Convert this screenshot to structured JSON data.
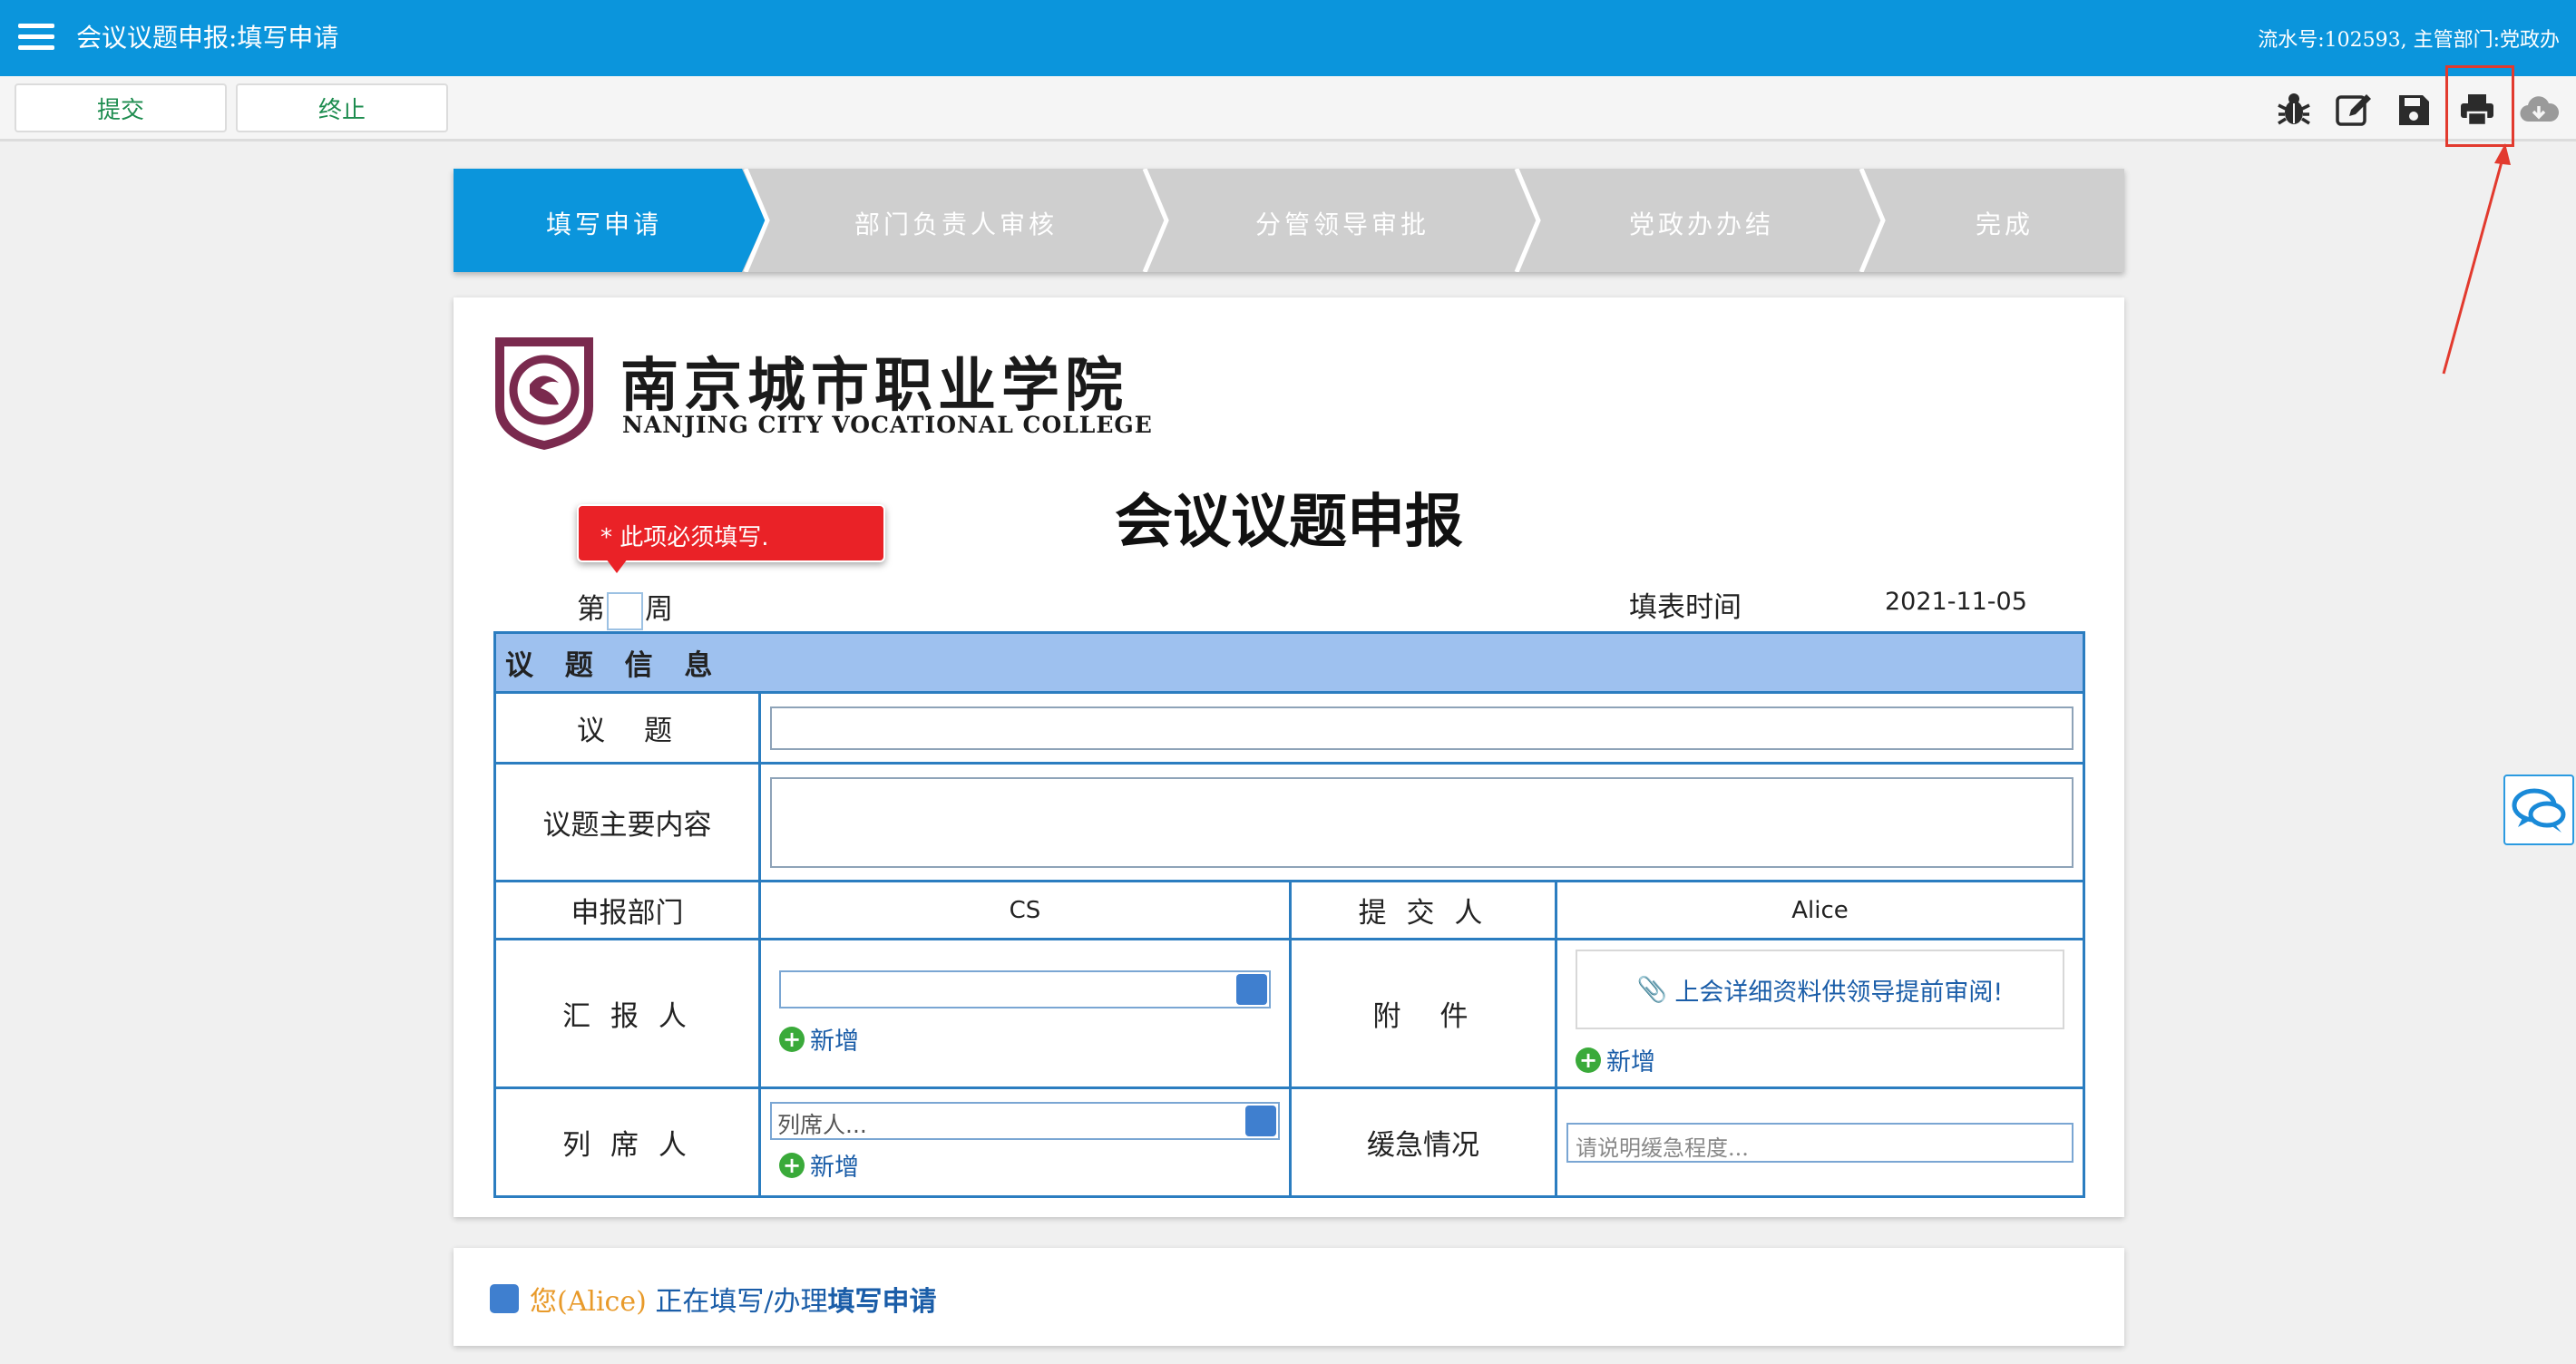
{
  "header": {
    "title": "会议议题申报:填写申请",
    "meta": "流水号:102593, 主管部门:党政办"
  },
  "toolbar": {
    "submit_label": "提交",
    "terminate_label": "终止",
    "icons": [
      "bug-icon",
      "edit-icon",
      "save-icon",
      "print-icon",
      "cloud-download-icon"
    ]
  },
  "steps": [
    {
      "label": "填写申请",
      "active": true
    },
    {
      "label": "部门负责人审核",
      "active": false
    },
    {
      "label": "分管领导审批",
      "active": false
    },
    {
      "label": "党政办办结",
      "active": false
    },
    {
      "label": "完成",
      "active": false
    }
  ],
  "colors": {
    "brand": "#0b95dc",
    "step_inactive": "#cfcfcf",
    "table_border": "#2b7dc0",
    "section_head": "#9ec1ef",
    "tooltip": "#ea2227",
    "logo": "#7a2a4e"
  },
  "logo": {
    "name_cn": "南京城市职业学院",
    "name_en": "NANJING CITY VOCATIONAL COLLEGE"
  },
  "form": {
    "title": "会议议题申报",
    "tooltip": "* 此项必须填写.",
    "week_prefix": "第",
    "week_suffix": "周",
    "date_label": "填表时间",
    "date_value": "2021-11-05",
    "section_title": "议 题 信 息",
    "topic_label": "议　题",
    "content_label": "议题主要内容",
    "dept_label": "申报部门",
    "dept_value": "CS",
    "submitter_label": "提 交 人",
    "submitter_value": "Alice",
    "reporter_label": "汇 报 人",
    "attachment_label": "附　件",
    "attachment_note": "上会详细资料供领导提前审阅!",
    "attendees_label": "列 席 人",
    "attendees_placeholder": "列席人...",
    "urgency_label": "缓急情况",
    "urgency_placeholder": "请说明缓急程度...",
    "add_label": "新增"
  },
  "status": {
    "user": "您(Alice)",
    "middle": "正在填写/办理",
    "step": "填写申请"
  }
}
